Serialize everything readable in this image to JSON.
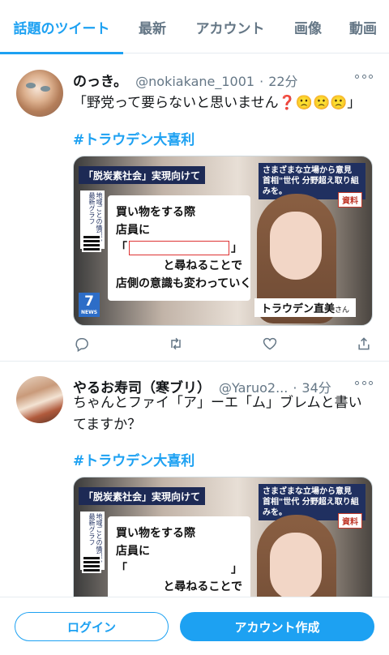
{
  "tabs": [
    {
      "label": "話題のツイート",
      "active": true
    },
    {
      "label": "最新"
    },
    {
      "label": "アカウント"
    },
    {
      "label": "画像"
    },
    {
      "label": "動画"
    }
  ],
  "tweets": [
    {
      "display_name": "のっき。",
      "handle": "@nokiakane_1001",
      "separator": "·",
      "time": "22分",
      "text": "「野党って要らないと思いません❓🙁🙁🙁」",
      "hashtag": "#トラウデン大喜利",
      "media": {
        "tag": "「脱炭素社会」実現向けて",
        "top_right": "さまざまな立場から意見 首相\"世代 分野超え取り組みを。",
        "doc_label": "資料",
        "side_text": "地域ごとの情報や 最新グラフ",
        "news_logo": "7",
        "news_small": "NEWS",
        "board_line1": "買い物をする際",
        "board_line2": "店員に",
        "bracket_open": "「",
        "bracket_close": "」",
        "board_line4": "と尋ねることで",
        "board_line5": "店側の意識も変わっていく",
        "caption_name": "トラウデン直美",
        "caption_suffix": "さん"
      }
    },
    {
      "display_name": "やるお寿司（寒ブリ）",
      "handle": "@Yaruo2...",
      "separator": "·",
      "time": "34分",
      "text": "ちゃんとファイ「ア」ーエ「ム」ブレムと書いてますか？",
      "hashtag": "#トラウデン大喜利",
      "media": {
        "tag": "「脱炭素社会」実現向けて",
        "top_right": "さまざまな立場から意見 首相\"世代 分野超え取り組みを。",
        "doc_label": "資料",
        "side_text": "地域ごとの情報や 最新グラフ",
        "board_line1": "買い物をする際",
        "board_line2": "店員に",
        "bracket_open": "「",
        "bracket_close": "」",
        "board_line4": "と尋ねることで"
      }
    }
  ],
  "bottom": {
    "login_label": "ログイン",
    "signup_label": "アカウント作成"
  },
  "colors": {
    "accent": "#1da1f2",
    "text": "#14171a",
    "muted": "#657786"
  }
}
